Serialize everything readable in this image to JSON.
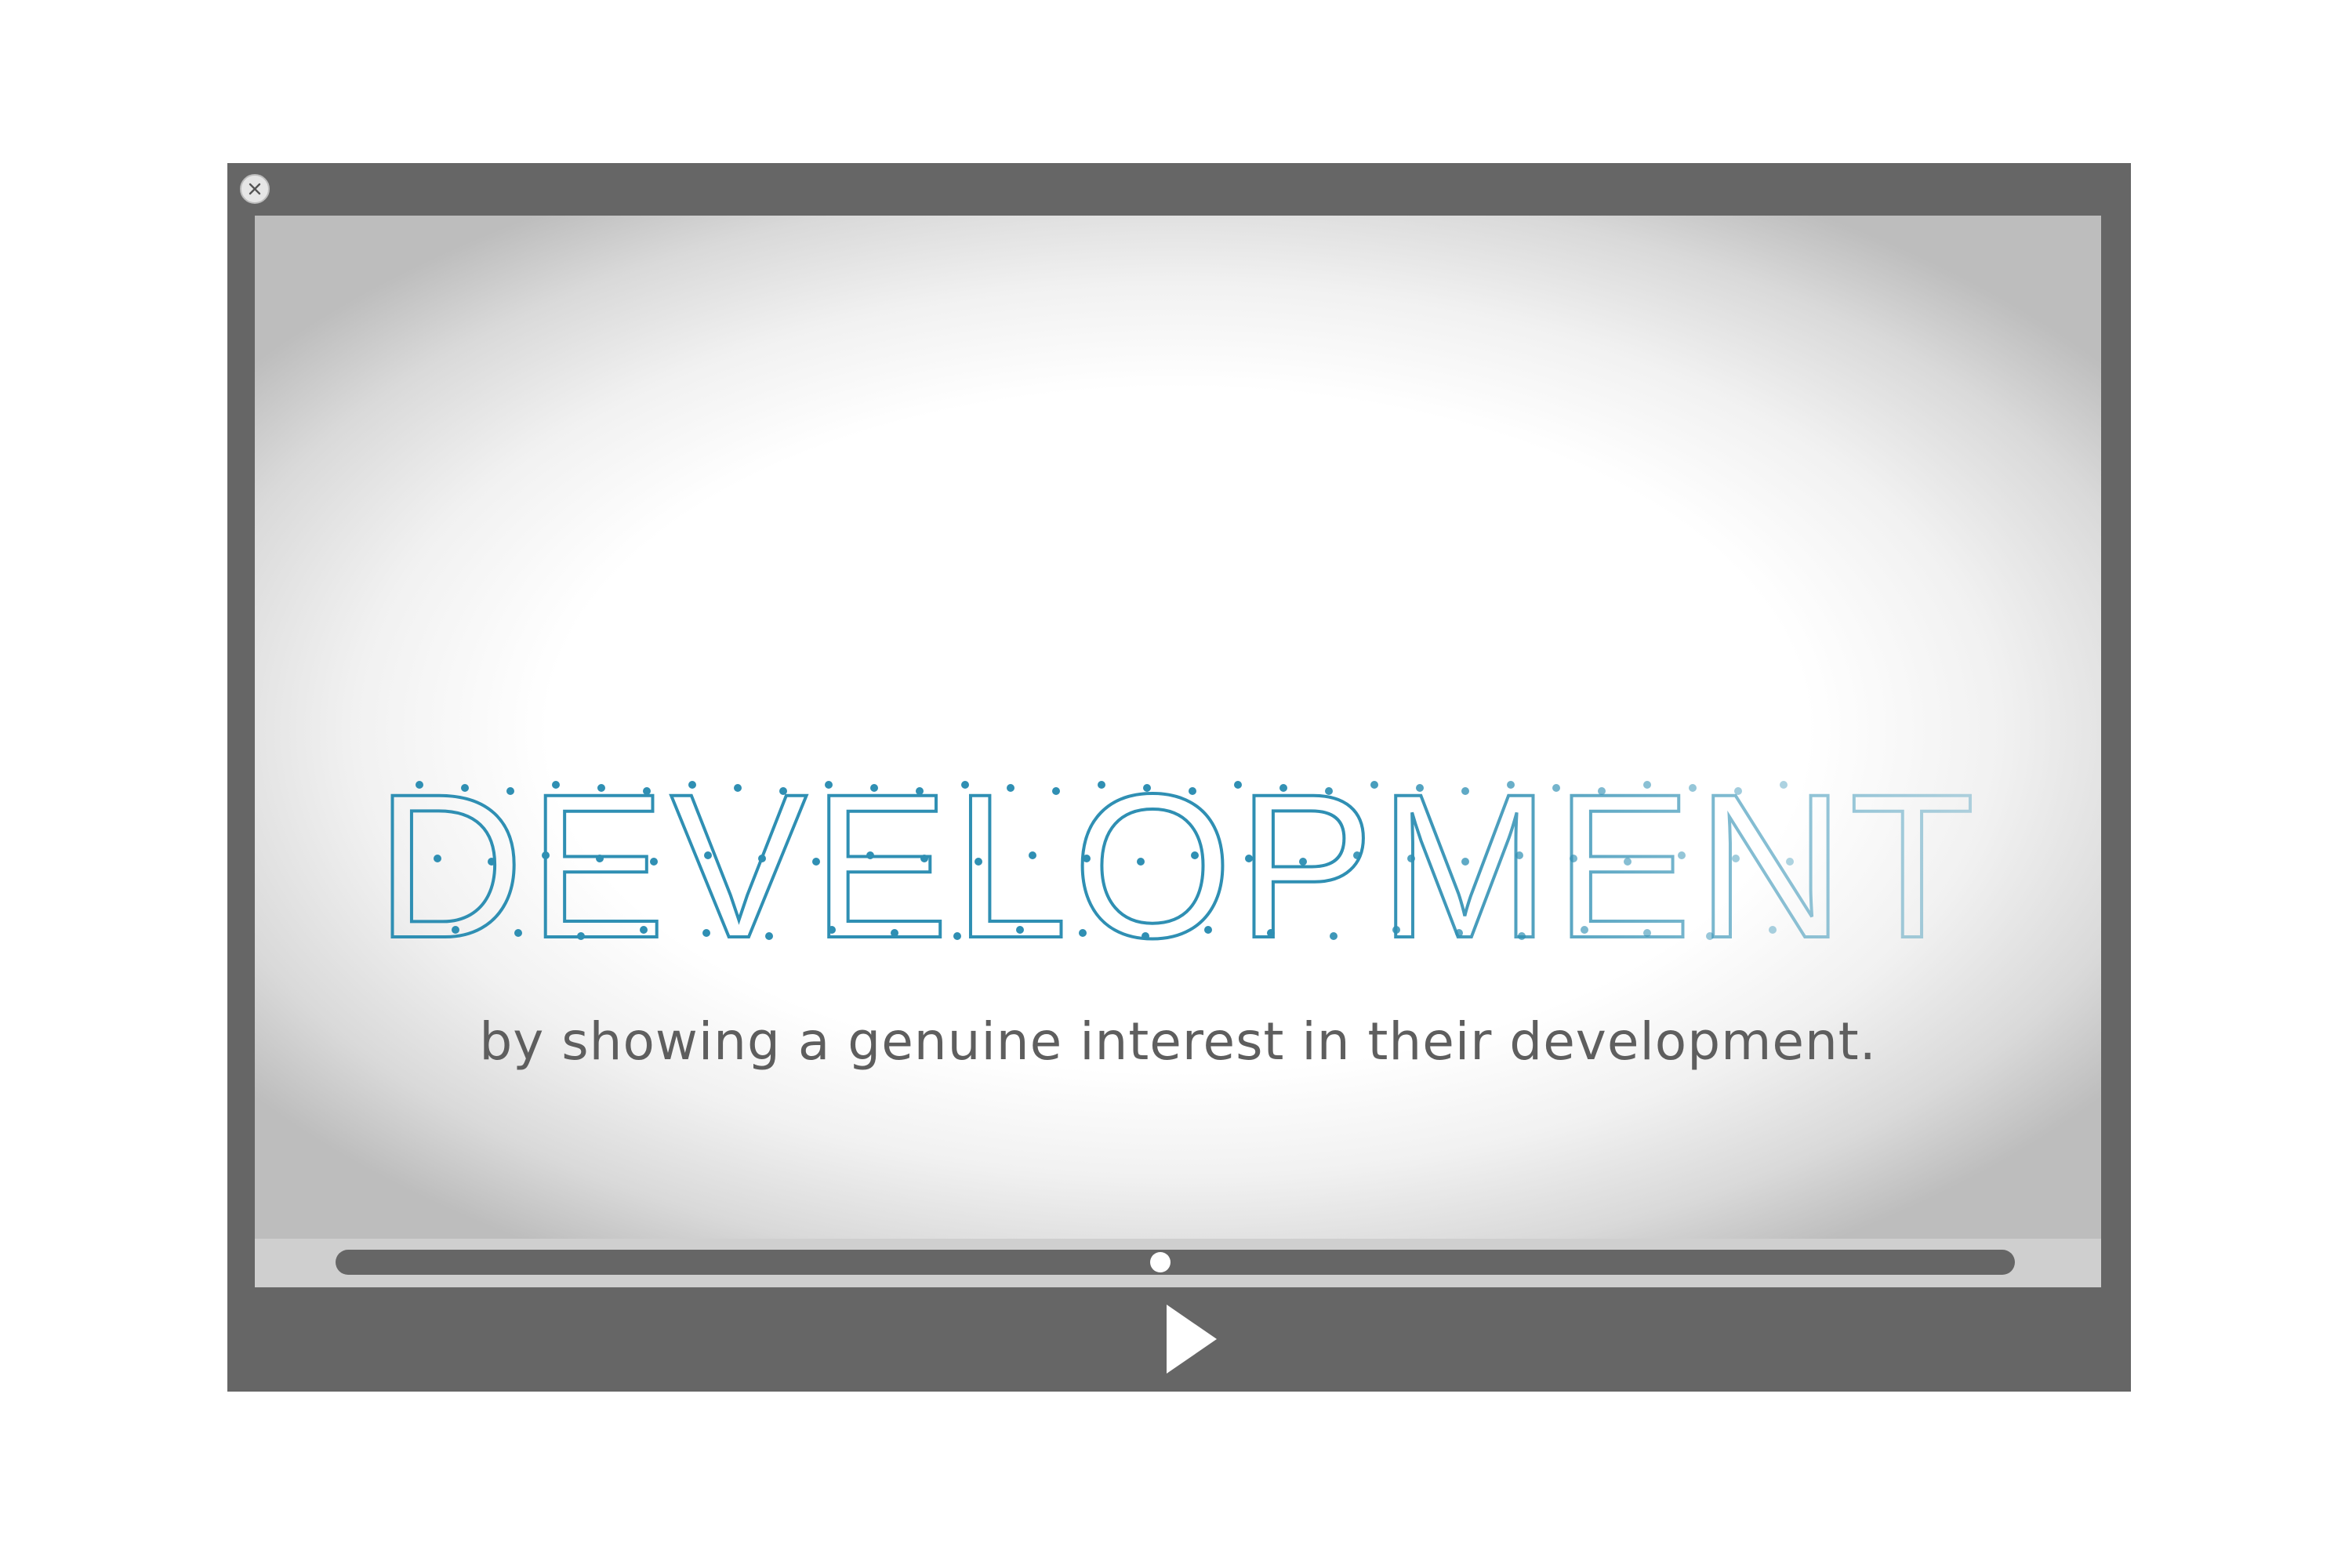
{
  "player": {
    "close_icon": "close-circle-icon",
    "play_icon": "play-triangle-icon",
    "progress_fraction": 0.491,
    "accent_color": "#2f8fb3",
    "frame_color": "#666666"
  },
  "video": {
    "title_text": "DEVELOPMENT",
    "caption": "by showing a genuine interest in their development."
  }
}
